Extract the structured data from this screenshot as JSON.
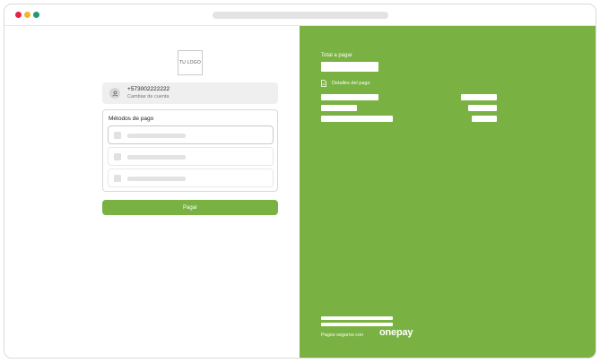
{
  "colors": {
    "brand_green": "#79b142",
    "dot_red": "#e5214a",
    "dot_yellow": "#f5b42a",
    "dot_green": "#1e9c6f"
  },
  "window": {
    "controls": [
      "close-dot",
      "minimize-dot",
      "maximize-dot"
    ]
  },
  "merchant": {
    "logo_text": "TU LOGO"
  },
  "account": {
    "icon": "user-icon",
    "phone": "+573002222222",
    "change_label": "Cambiar de cuenta"
  },
  "payment_methods": {
    "title": "Métodos de pago",
    "selected_index": 0,
    "options": [
      {
        "selected": true
      },
      {
        "selected": false
      },
      {
        "selected": false
      }
    ]
  },
  "pay_button": {
    "label": "Pagar"
  },
  "summary": {
    "total_label": "Total a pagar",
    "details_icon": "document-icon",
    "details_label": "Detalles del pago"
  },
  "footer": {
    "secure_text": "Pagos seguros con",
    "brand": "onepay"
  }
}
